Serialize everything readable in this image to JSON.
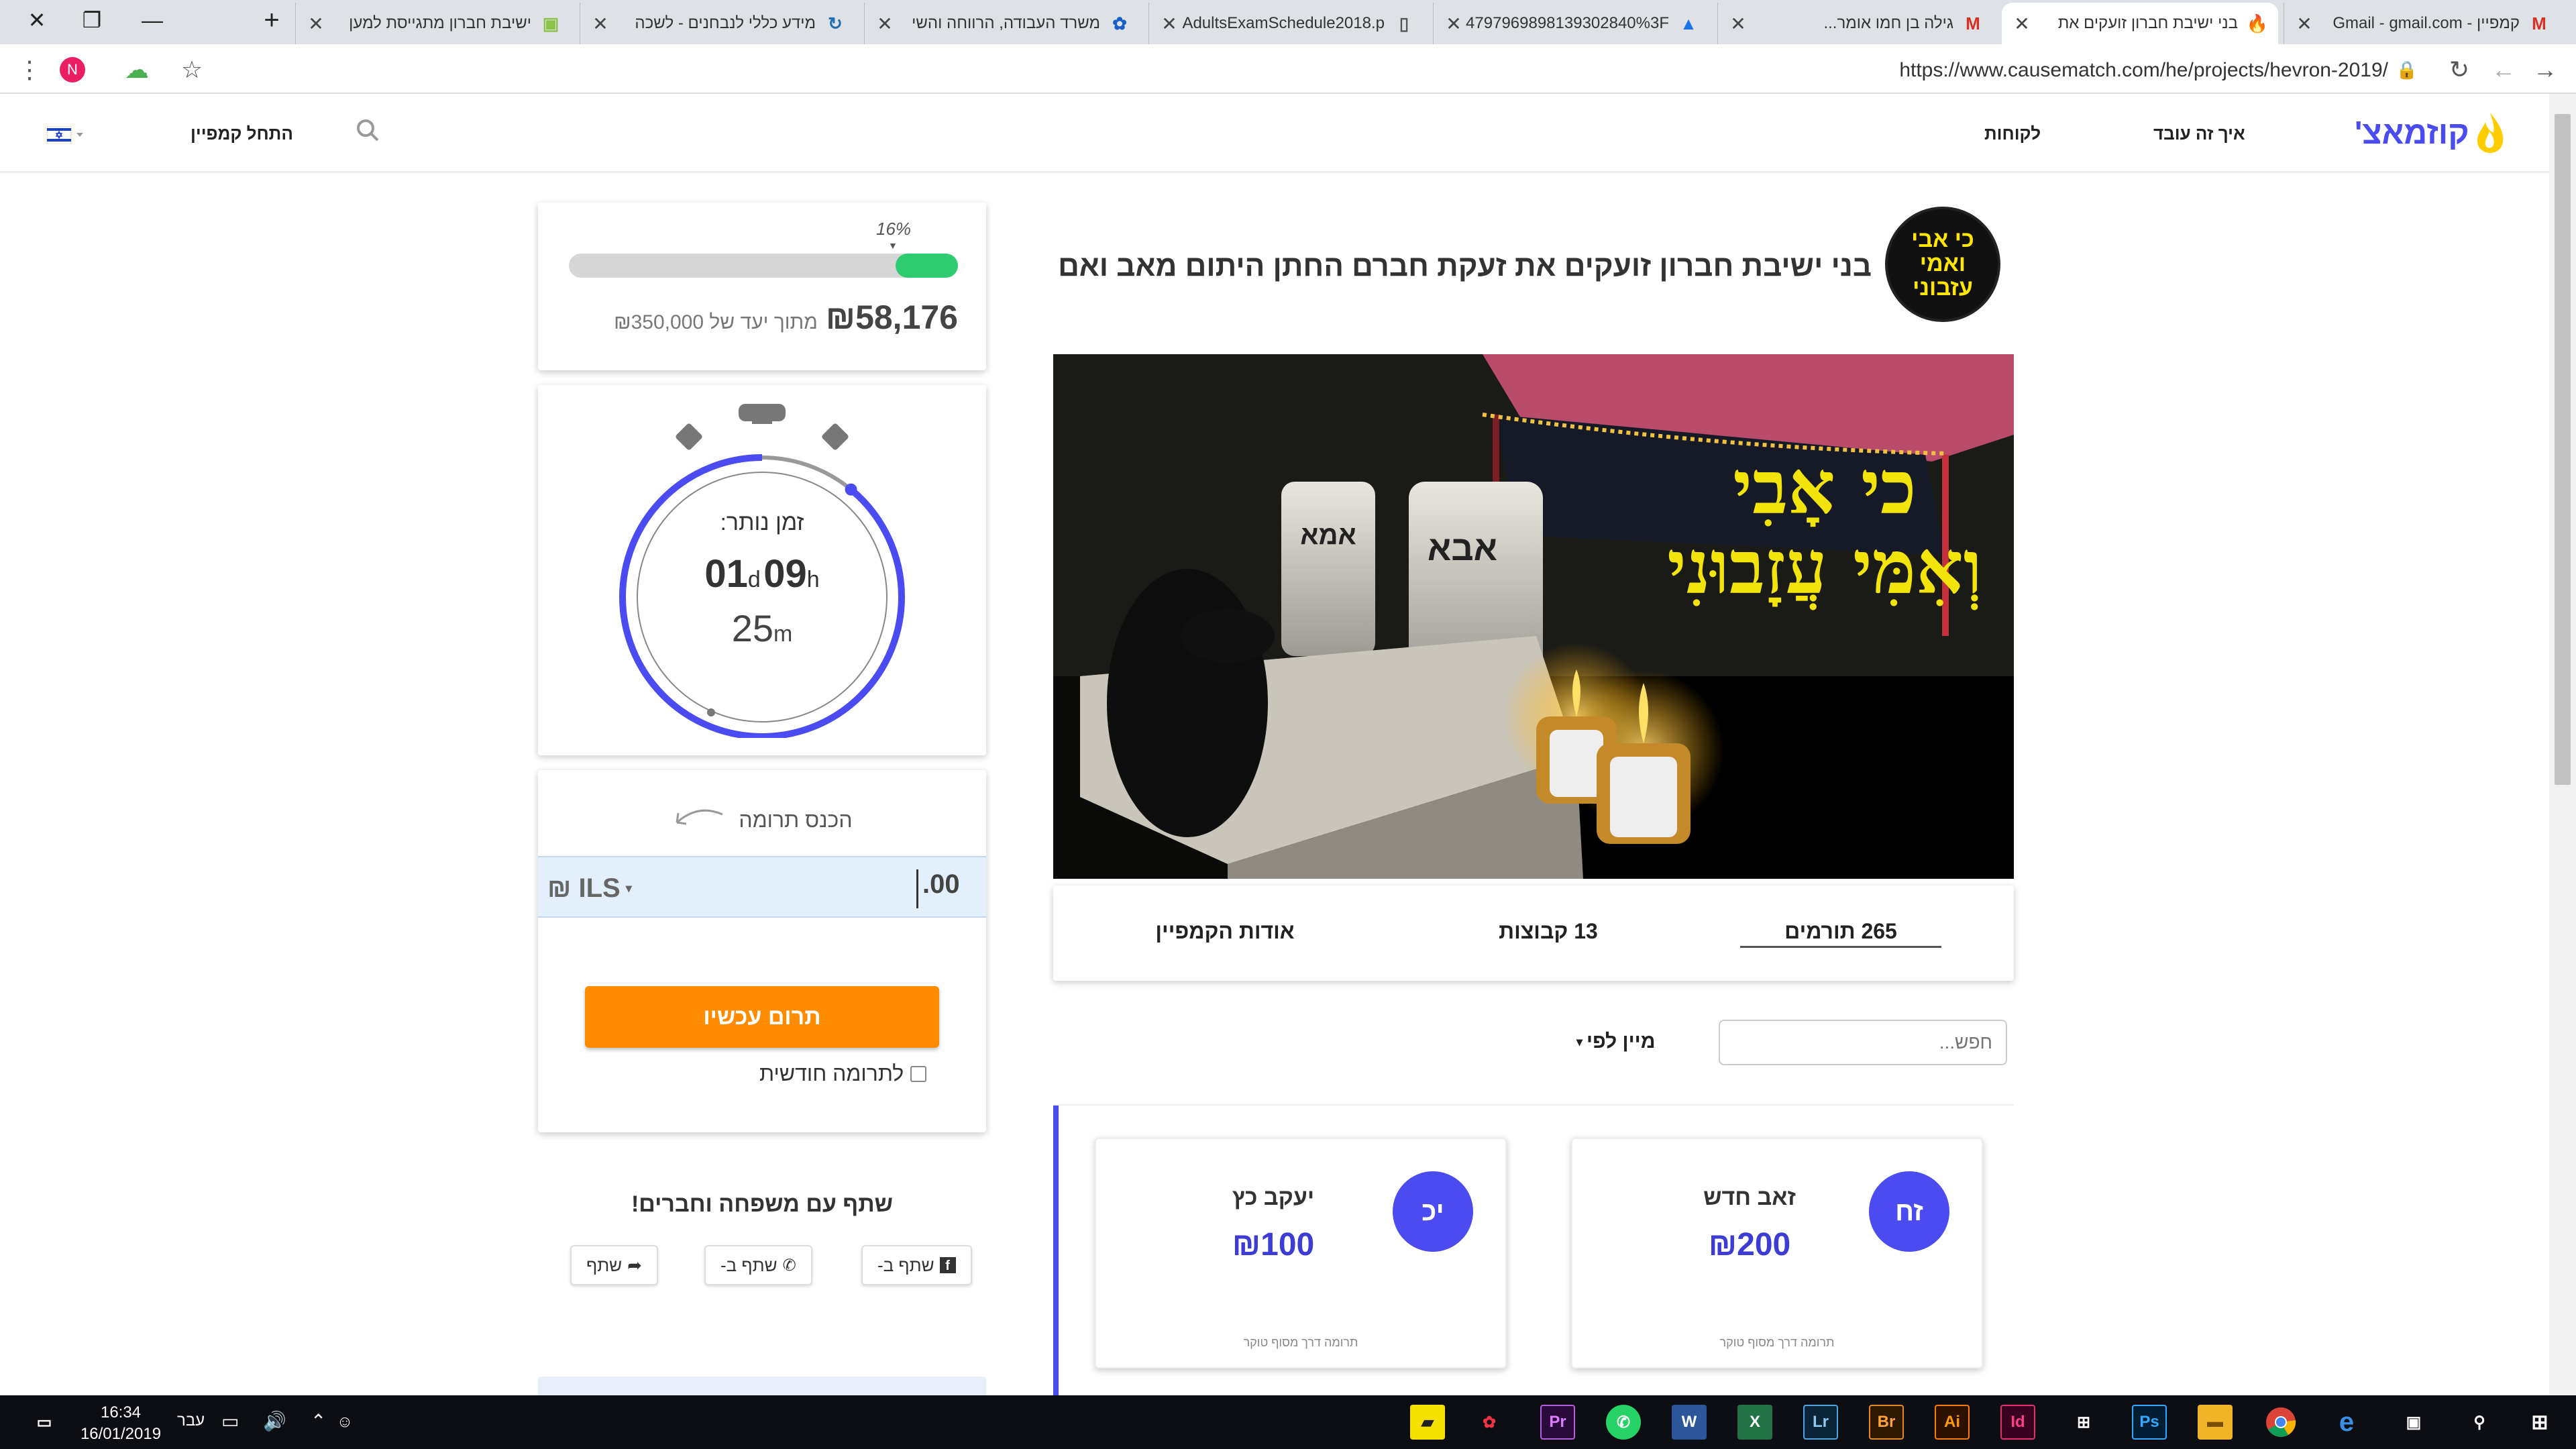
{
  "browser": {
    "tabs": [
      {
        "title": "קמפיין - Gmail - gmail.com",
        "fav": "M",
        "fav_color": "#d93025"
      },
      {
        "title": "בני ישיבת חברון זועקים את",
        "fav": "🔥",
        "fav_color": "#f4b400",
        "active": true
      },
      {
        "title": "גילה בן חמו אומר...",
        "fav": "M",
        "fav_color": "#d93025"
      },
      {
        "title": "4797969898139302840%3F",
        "fav": "▲",
        "fav_color": "#1a73e8"
      },
      {
        "title": "AdultsExamSchedule2018.p",
        "fav": "▯",
        "fav_color": "#555"
      },
      {
        "title": "משרד העבודה, הרווחה והשי",
        "fav": "✿",
        "fav_color": "#1a5ec8"
      },
      {
        "title": "מידע כללי לנבחנים - לשכה",
        "fav": "↻",
        "fav_color": "#1f6fb4"
      },
      {
        "title": "ישיבת חברון מתגייסת למען",
        "fav": "▣",
        "fav_color": "#8bc34a"
      }
    ],
    "url": "https://www.causematch.com/he/projects/hevron-2019/"
  },
  "header": {
    "brand": "קוזמאצ'",
    "nav_how": "איך זה עובד",
    "nav_clients": "לקוחות",
    "start_campaign": "התחל קמפיין"
  },
  "campaign": {
    "title": "בני ישיבת חברון זועקים את זעקת חברם החתן היתום מאב ואם",
    "logo_text": "כי אבי ואמי עזבוני",
    "banner_text": "כי אָבִי וְאִמִּי עֲזָבוּנִי",
    "stone_mother": "אמא",
    "stone_father": "אבא",
    "tabs": {
      "donors": "265 תורמים",
      "groups": "13 קבוצות",
      "about": "אודות הקמפיין"
    },
    "search_placeholder": "חפש...",
    "sort_label": "מיין לפי"
  },
  "donors": [
    {
      "initials": "זח",
      "name": "זאב חדש",
      "amount": "₪200",
      "note": "תרומה דרך מסוף טוקר"
    },
    {
      "initials": "יכ",
      "name": "יעקב כץ",
      "amount": "₪100",
      "note": "תרומה דרך מסוף טוקר"
    }
  ],
  "progress": {
    "percent_label": "16%",
    "percent": 16,
    "raised": "₪58,176",
    "goal_text": "מתוך יעד של ₪350,000"
  },
  "timer": {
    "label": "זמן נותר:",
    "days": "01",
    "days_unit": "d",
    "hours": "09",
    "hours_unit": "h",
    "minutes": "25",
    "minutes_unit": "m",
    "remaining_fraction": 0.89
  },
  "donate": {
    "enter_label": "הכנס תרומה",
    "currency": "₪ ILS",
    "amount": ".00",
    "button": "תרום עכשיו",
    "monthly": "לתרומה חודשית"
  },
  "share": {
    "title": "שתף עם משפחה וחברים!",
    "facebook": "שתף ב-",
    "whatsapp": "שתף ב-",
    "share": "שתף"
  },
  "taskbar": {
    "time": "16:34",
    "date": "16/01/2019",
    "lang": "עבר"
  },
  "colors": {
    "brand_blue": "#4a4bf0",
    "progress_green": "#2ecc71",
    "donate_orange": "#ff8c00"
  }
}
